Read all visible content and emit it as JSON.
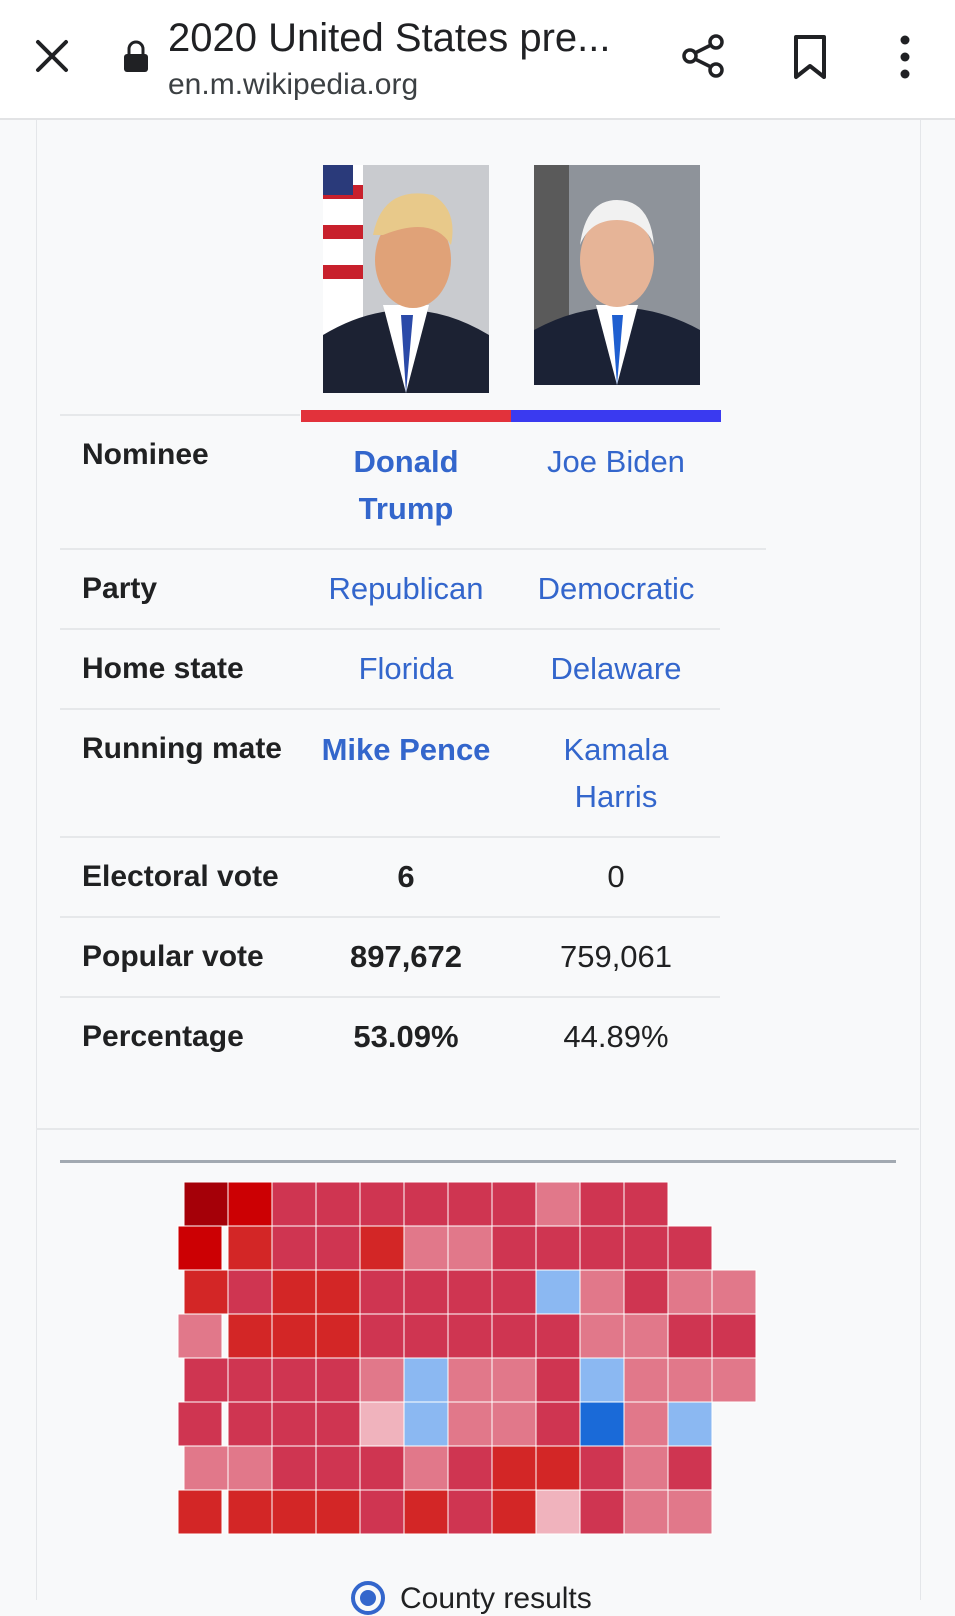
{
  "browser": {
    "title": "2020 United States pre...",
    "url": "en.m.wikipedia.org"
  },
  "infobox": {
    "rows": {
      "nominee": {
        "label": "Nominee",
        "a": "Donald Trump",
        "b": "Joe Biden"
      },
      "party": {
        "label": "Party",
        "a": "Republican",
        "b": "Democratic"
      },
      "home_state": {
        "label": "Home state",
        "a": "Florida",
        "b": "Delaware"
      },
      "running_mate": {
        "label": "Running mate",
        "a": "Mike Pence",
        "b": "Kamala Harris"
      },
      "electoral_vote": {
        "label": "Electoral vote",
        "a": "6",
        "b": "0"
      },
      "popular_vote": {
        "label": "Popular vote",
        "a": "897,672",
        "b": "759,061"
      },
      "percentage": {
        "label": "Percentage",
        "a": "53.09%",
        "b": "44.89%"
      }
    },
    "party_colors": {
      "republican": "#e2323b",
      "democratic": "#3a3af0"
    }
  },
  "map": {
    "radio_label": "County results",
    "palette": {
      "r90": "#a50008",
      "r80": "#cc0003",
      "r70": "#d32626",
      "r60": "#cf3551",
      "r50": "#e1788a",
      "r40": "#f0b3bd",
      "d40": "#8bb8f2",
      "d50": "#1a6ad8"
    }
  }
}
